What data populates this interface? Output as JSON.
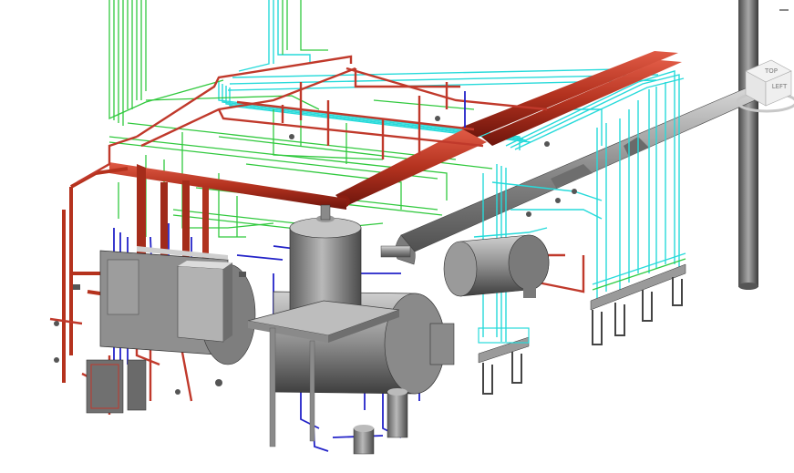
{
  "view": {
    "viewcube": {
      "top": "TOP",
      "left": "LEFT"
    },
    "colors": {
      "background": "#ffffff",
      "hot_pipe": "#c0392b",
      "hot_pipe_dark": "#7a1d14",
      "supply_pipe": "#2ecc40",
      "return_pipe": "#2ee0e0",
      "cold_pipe": "#2222cc",
      "duct_gray": "#8c8c8c",
      "equipment_gray": "#9a9a9a"
    }
  }
}
